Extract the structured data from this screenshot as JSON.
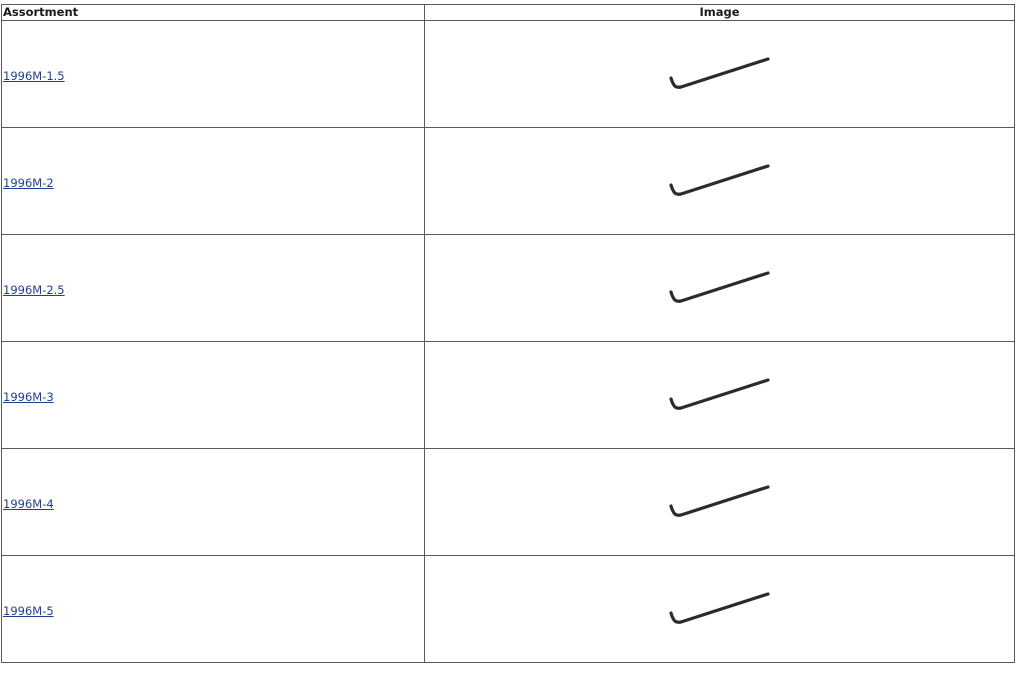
{
  "table": {
    "headers": {
      "assortment": "Assortment",
      "image": "Image"
    },
    "rows": [
      {
        "assortment": "1996M-1.5",
        "image_icon": "hex-key-icon"
      },
      {
        "assortment": "1996M-2",
        "image_icon": "hex-key-icon"
      },
      {
        "assortment": "1996M-2.5",
        "image_icon": "hex-key-icon"
      },
      {
        "assortment": "1996M-3",
        "image_icon": "hex-key-icon"
      },
      {
        "assortment": "1996M-4",
        "image_icon": "hex-key-icon"
      },
      {
        "assortment": "1996M-5",
        "image_icon": "hex-key-icon"
      }
    ]
  },
  "colors": {
    "link": "#1f3f8f",
    "border": "#5a5a5a",
    "wrench": "#2b2b2b"
  }
}
